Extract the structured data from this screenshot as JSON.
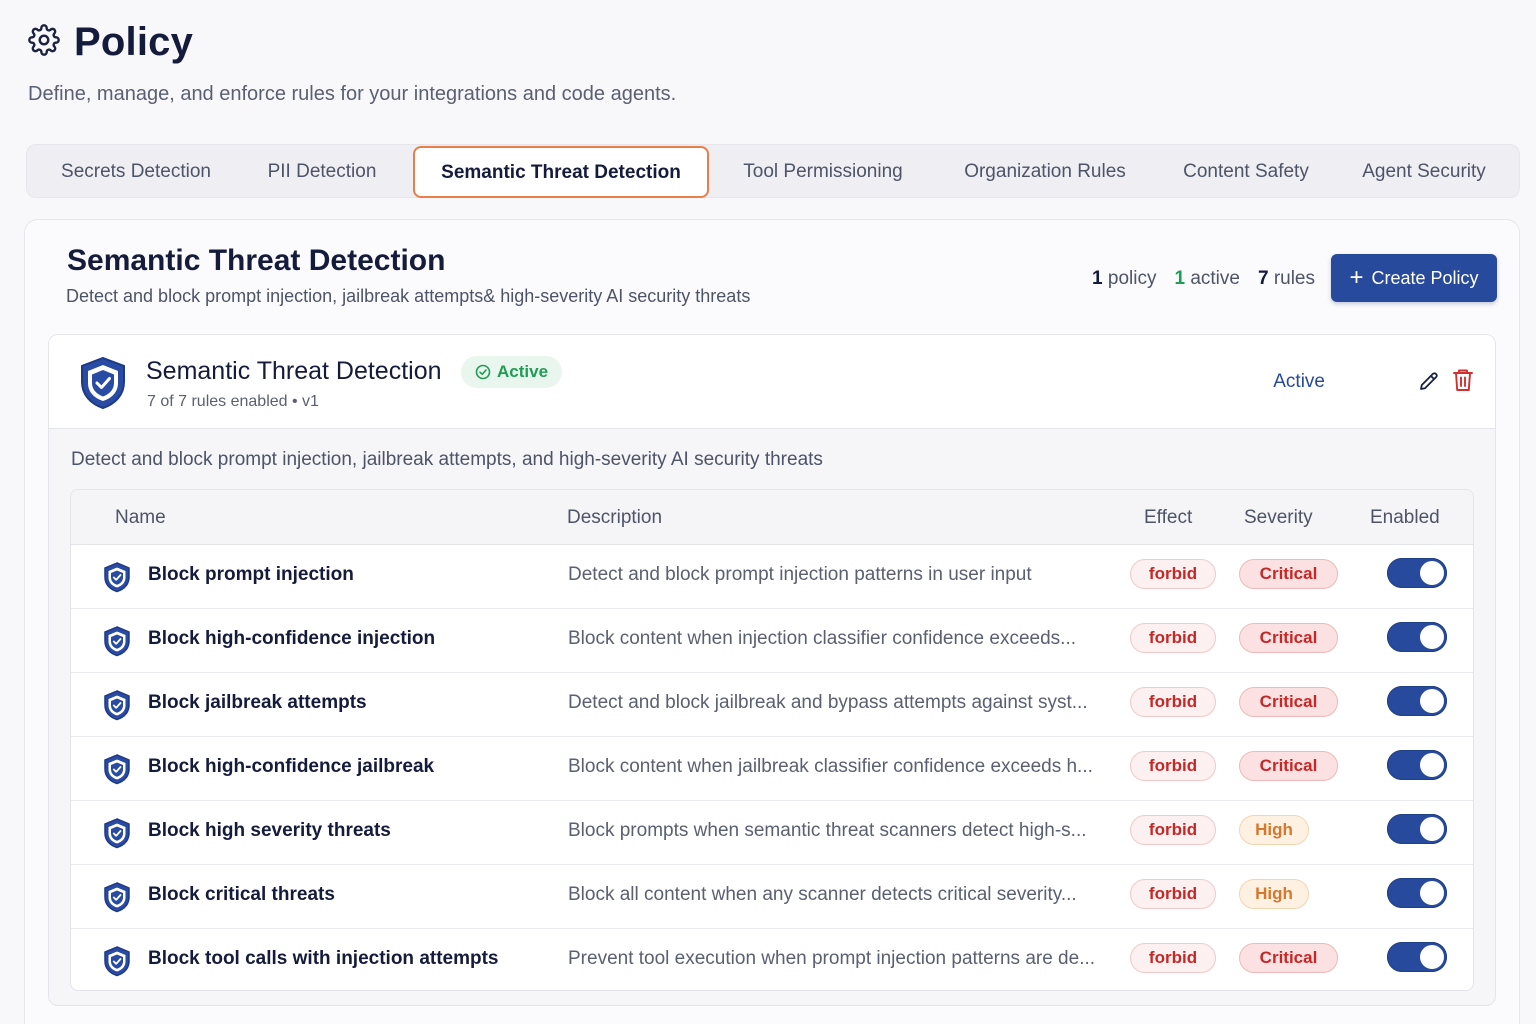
{
  "page": {
    "title": "Policy",
    "subtitle": "Define, manage, and enforce rules for your integrations and code agents."
  },
  "tabs": [
    {
      "label": "Secrets Detection"
    },
    {
      "label": "PII Detection"
    },
    {
      "label": "Semantic Threat Detection",
      "active": true
    },
    {
      "label": "Tool Permissioning"
    },
    {
      "label": "Organization Rules"
    },
    {
      "label": "Content Safety"
    },
    {
      "label": "Agent Security"
    }
  ],
  "section": {
    "title": "Semantic Threat Detection",
    "description": "Detect and block prompt injection, jailbreak attempts& high-severity AI security threats",
    "stats": {
      "policy_count": "1",
      "policy_label": "policy",
      "active_count": "1",
      "active_label": "active",
      "rules_count": "7",
      "rules_label": "rules"
    },
    "create_button": "Create Policy"
  },
  "policy": {
    "name": "Semantic Threat Detection",
    "status_badge": "Active",
    "meta": "7 of 7 rules enabled • v1",
    "toggle_label": "Active",
    "enabled": true,
    "description": "Detect and block prompt injection, jailbreak attempts, and high-severity AI security threats"
  },
  "table": {
    "columns": [
      "Name",
      "Description",
      "Effect",
      "Severity",
      "Enabled"
    ],
    "rows": [
      {
        "name": "Block prompt injection",
        "description": "Detect and block prompt injection patterns in user input",
        "effect": "forbid",
        "severity": "Critical",
        "enabled": true
      },
      {
        "name": "Block high-confidence injection",
        "description": "Block content when injection classifier confidence exceeds...",
        "effect": "forbid",
        "severity": "Critical",
        "enabled": true
      },
      {
        "name": "Block jailbreak attempts",
        "description": "Detect and block jailbreak and bypass attempts against syst...",
        "effect": "forbid",
        "severity": "Critical",
        "enabled": true
      },
      {
        "name": "Block high-confidence jailbreak",
        "description": "Block content when jailbreak classifier confidence exceeds h...",
        "effect": "forbid",
        "severity": "Critical",
        "enabled": true
      },
      {
        "name": "Block high severity threats",
        "description": "Block prompts when semantic threat scanners detect high-s...",
        "effect": "forbid",
        "severity": "High",
        "enabled": true
      },
      {
        "name": "Block critical threats",
        "description": "Block all content when any scanner detects critical severity...",
        "effect": "forbid",
        "severity": "High",
        "enabled": true
      },
      {
        "name": "Block tool calls with injection attempts",
        "description": "Prevent tool execution when prompt injection patterns are de...",
        "effect": "forbid",
        "severity": "Critical",
        "enabled": true
      }
    ]
  },
  "icons": {
    "page": "gear-icon",
    "policy": "shield-check-icon",
    "rule": "shield-check-icon",
    "edit": "pencil-icon",
    "delete": "trash-icon",
    "badge": "check-circle-icon",
    "create": "plus-icon"
  },
  "colors": {
    "primary": "#274a9c",
    "active_tab_border": "#ea7d4a",
    "success": "#1f9d55",
    "danger": "#c62828",
    "warning": "#d8772c"
  }
}
